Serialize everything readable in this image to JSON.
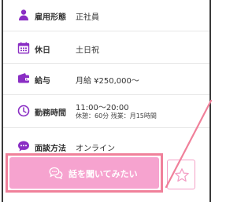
{
  "job_details": [
    {
      "icon": "person-icon",
      "label": "雇用形態",
      "value": "正社員"
    },
    {
      "icon": "calendar-icon",
      "label": "休日",
      "value": "土日祝"
    },
    {
      "icon": "wallet-icon",
      "label": "給与",
      "value": "月給 ¥250,000〜"
    },
    {
      "icon": "clock-icon",
      "label": "勤務時間",
      "value": "11:00〜20:00",
      "subvalue": "休憩：60分 残業：月15時間"
    },
    {
      "icon": "chat-icon",
      "label": "面談方法",
      "value": "オンライン"
    }
  ],
  "cta": {
    "label": "話を聞いてみたい",
    "icon": "chat-bubbles-icon"
  },
  "favorite": {
    "icon": "star-icon"
  },
  "colors": {
    "accent_purple": "#8a2ec4",
    "cta_pink": "#f6a3cf",
    "highlight_red": "#f0809a"
  }
}
